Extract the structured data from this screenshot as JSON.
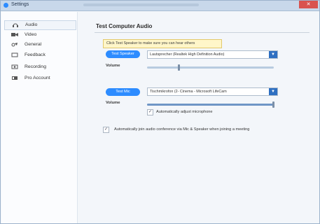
{
  "window": {
    "title": "Settings",
    "close_glyph": "✕"
  },
  "sidebar": {
    "items": [
      {
        "label": "Audio",
        "icon": "headphones-icon"
      },
      {
        "label": "Video",
        "icon": "video-camera-icon"
      },
      {
        "label": "General",
        "icon": "settings-icon"
      },
      {
        "label": "Feedback",
        "icon": "chat-icon"
      },
      {
        "label": "Recording",
        "icon": "record-icon"
      },
      {
        "label": "Pro Account",
        "icon": "account-icon"
      }
    ],
    "active_index": 0
  },
  "audio": {
    "heading": "Test Computer Audio",
    "hint": "Click Test Speaker to make sure you can hear others",
    "test_speaker_label": "Test Speaker",
    "speaker_device": "Lautsprecher (Realtek High Definition Audio)",
    "speaker_volume_label": "Volume",
    "speaker_volume_fraction": 0.25,
    "test_mic_label": "Test Mic",
    "mic_device": "Tischmikrofon (2- Cinema - Microsoft LifeCam",
    "mic_volume_label": "Volume",
    "mic_volume_fraction": 1.0,
    "auto_adjust_label": "Automatically adjust microphone",
    "auto_adjust_checked": true,
    "auto_join_label": "Automatically join audio conference via Mic & Speaker when joining a meeting",
    "auto_join_checked": true
  },
  "colors": {
    "accent": "#2d8cff",
    "dropdown_arrow": "#2e6fc1",
    "hint_bg": "#fff6c9"
  }
}
